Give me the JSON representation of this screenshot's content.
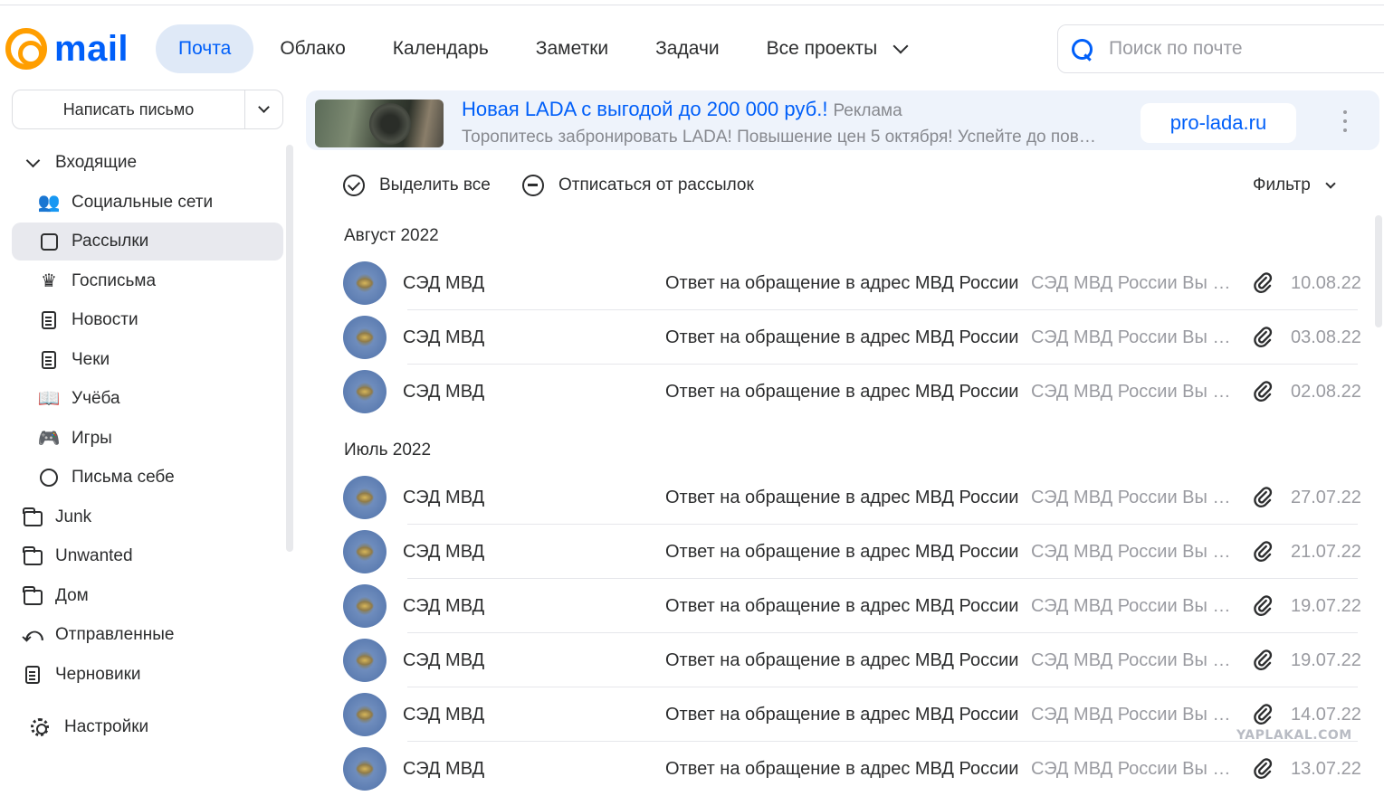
{
  "header": {
    "logo_text": "mail",
    "nav": [
      "Почта",
      "Облако",
      "Календарь",
      "Заметки",
      "Задачи",
      "Все проекты"
    ],
    "active_nav": "Почта",
    "search_placeholder": "Поиск по почте"
  },
  "sidebar": {
    "compose_label": "Написать письмо",
    "inbox": "Входящие",
    "items": [
      {
        "label": "Социальные сети",
        "icon": "people-icon"
      },
      {
        "label": "Рассылки",
        "icon": "newsletter-icon"
      },
      {
        "label": "Госписьма",
        "icon": "emblem-icon"
      },
      {
        "label": "Новости",
        "icon": "news-icon"
      },
      {
        "label": "Чеки",
        "icon": "receipt-icon"
      },
      {
        "label": "Учёба",
        "icon": "book-icon"
      },
      {
        "label": "Игры",
        "icon": "gamepad-icon"
      },
      {
        "label": "Письма себе",
        "icon": "self-mail-icon"
      }
    ],
    "folders": [
      "Junk",
      "Unwanted",
      "Дом"
    ],
    "sent": "Отправленные",
    "drafts": "Черновики",
    "settings": "Настройки"
  },
  "ad": {
    "title": "Новая LADA с выгодой до 200 000 руб.!",
    "tag": "Реклама",
    "subtitle": "Торопитесь забронировать LADA! Повышение цен 5 октября! Успейте до повышения цен",
    "button": "pro-lada.ru"
  },
  "toolbar": {
    "select_all": "Выделить все",
    "unsubscribe": "Отписаться от рассылок",
    "filter": "Фильтр"
  },
  "groups": [
    {
      "month": "Август 2022",
      "emails": [
        {
          "sender": "СЭД МВД",
          "subject": "Ответ на обращение в адрес МВД России",
          "snippet": "СЭД МВД России Вы писали",
          "date": "10.08.22"
        },
        {
          "sender": "СЭД МВД",
          "subject": "Ответ на обращение в адрес МВД России",
          "snippet": "СЭД МВД России Вы писали",
          "date": "03.08.22"
        },
        {
          "sender": "СЭД МВД",
          "subject": "Ответ на обращение в адрес МВД России",
          "snippet": "СЭД МВД России Вы писали",
          "date": "02.08.22"
        }
      ]
    },
    {
      "month": "Июль 2022",
      "emails": [
        {
          "sender": "СЭД МВД",
          "subject": "Ответ на обращение в адрес МВД России",
          "snippet": "СЭД МВД России Вы писали",
          "date": "27.07.22"
        },
        {
          "sender": "СЭД МВД",
          "subject": "Ответ на обращение в адрес МВД России",
          "snippet": "СЭД МВД России Вы писали",
          "date": "21.07.22"
        },
        {
          "sender": "СЭД МВД",
          "subject": "Ответ на обращение в адрес МВД России",
          "snippet": "СЭД МВД России Вы писали",
          "date": "19.07.22"
        },
        {
          "sender": "СЭД МВД",
          "subject": "Ответ на обращение в адрес МВД России",
          "snippet": "СЭД МВД России Вы писали",
          "date": "19.07.22"
        },
        {
          "sender": "СЭД МВД",
          "subject": "Ответ на обращение в адрес МВД России",
          "snippet": "СЭД МВД России Вы писали",
          "date": "14.07.22"
        },
        {
          "sender": "СЭД МВД",
          "subject": "Ответ на обращение в адрес МВД России",
          "snippet": "СЭД МВД России Вы писали",
          "date": "13.07.22"
        }
      ]
    }
  ],
  "watermark": "YAPLAKAL.COM",
  "colors": {
    "accent": "#005ff9",
    "logo_orange": "#ff9e00",
    "muted_text": "#9a9ba1"
  }
}
